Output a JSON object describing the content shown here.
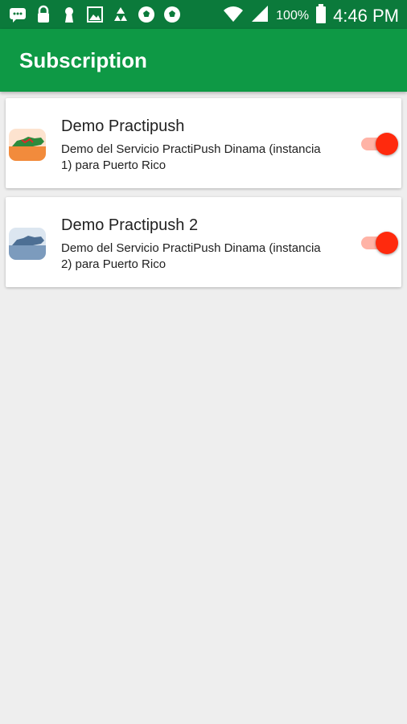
{
  "status_bar": {
    "battery": "100%",
    "time": "4:46 PM",
    "icons": [
      "messages-icon",
      "lock-icon",
      "keyhole-icon",
      "image-icon",
      "recycle-icon",
      "soccer-icon",
      "soccer-icon",
      "wifi-icon",
      "signal-icon",
      "battery-icon"
    ]
  },
  "app_bar": {
    "title": "Subscription"
  },
  "subscriptions": [
    {
      "name": "Demo Practipush",
      "description": "Demo del Servicio PractiPush Dinama (instancia 1) para Puerto Rico",
      "enabled": true,
      "icon": "puerto-rico-green-icon"
    },
    {
      "name": "Demo Practipush 2",
      "description": "Demo del Servicio PractiPush Dinama (instancia 2) para Puerto Rico",
      "enabled": true,
      "icon": "puerto-rico-blue-icon"
    }
  ],
  "colors": {
    "status_bar": "#0b7a3b",
    "app_bar": "#0e9945",
    "toggle_thumb": "#ff2a0d",
    "toggle_track": "#ffb3a6",
    "background": "#eeeeee"
  }
}
